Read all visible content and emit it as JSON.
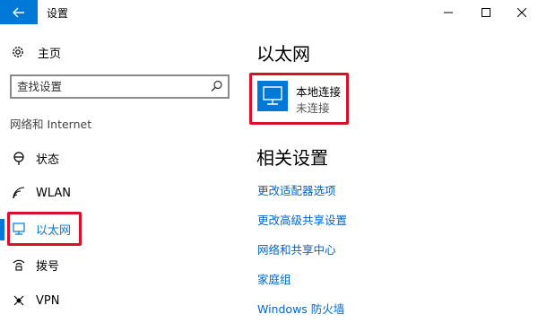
{
  "window": {
    "title": "设置",
    "accent_color": "#0078d7",
    "highlight_color": "#d8102a"
  },
  "sidebar": {
    "home_label": "主页",
    "search_placeholder": "查找设置",
    "section_header": "网络和 Internet",
    "items": [
      {
        "label": "状态",
        "icon": "status-icon",
        "active": false
      },
      {
        "label": "WLAN",
        "icon": "wifi-icon",
        "active": false
      },
      {
        "label": "以太网",
        "icon": "ethernet-icon",
        "active": true
      },
      {
        "label": "拨号",
        "icon": "dialup-icon",
        "active": false
      },
      {
        "label": "VPN",
        "icon": "vpn-icon",
        "active": false
      }
    ]
  },
  "main": {
    "title": "以太网",
    "connection": {
      "name": "本地连接",
      "status": "未连接",
      "icon": "monitor-network-icon"
    },
    "related_title": "相关设置",
    "related_links": [
      "更改适配器选项",
      "更改高级共享设置",
      "网络和共享中心",
      "家庭组",
      "Windows 防火墙"
    ]
  }
}
